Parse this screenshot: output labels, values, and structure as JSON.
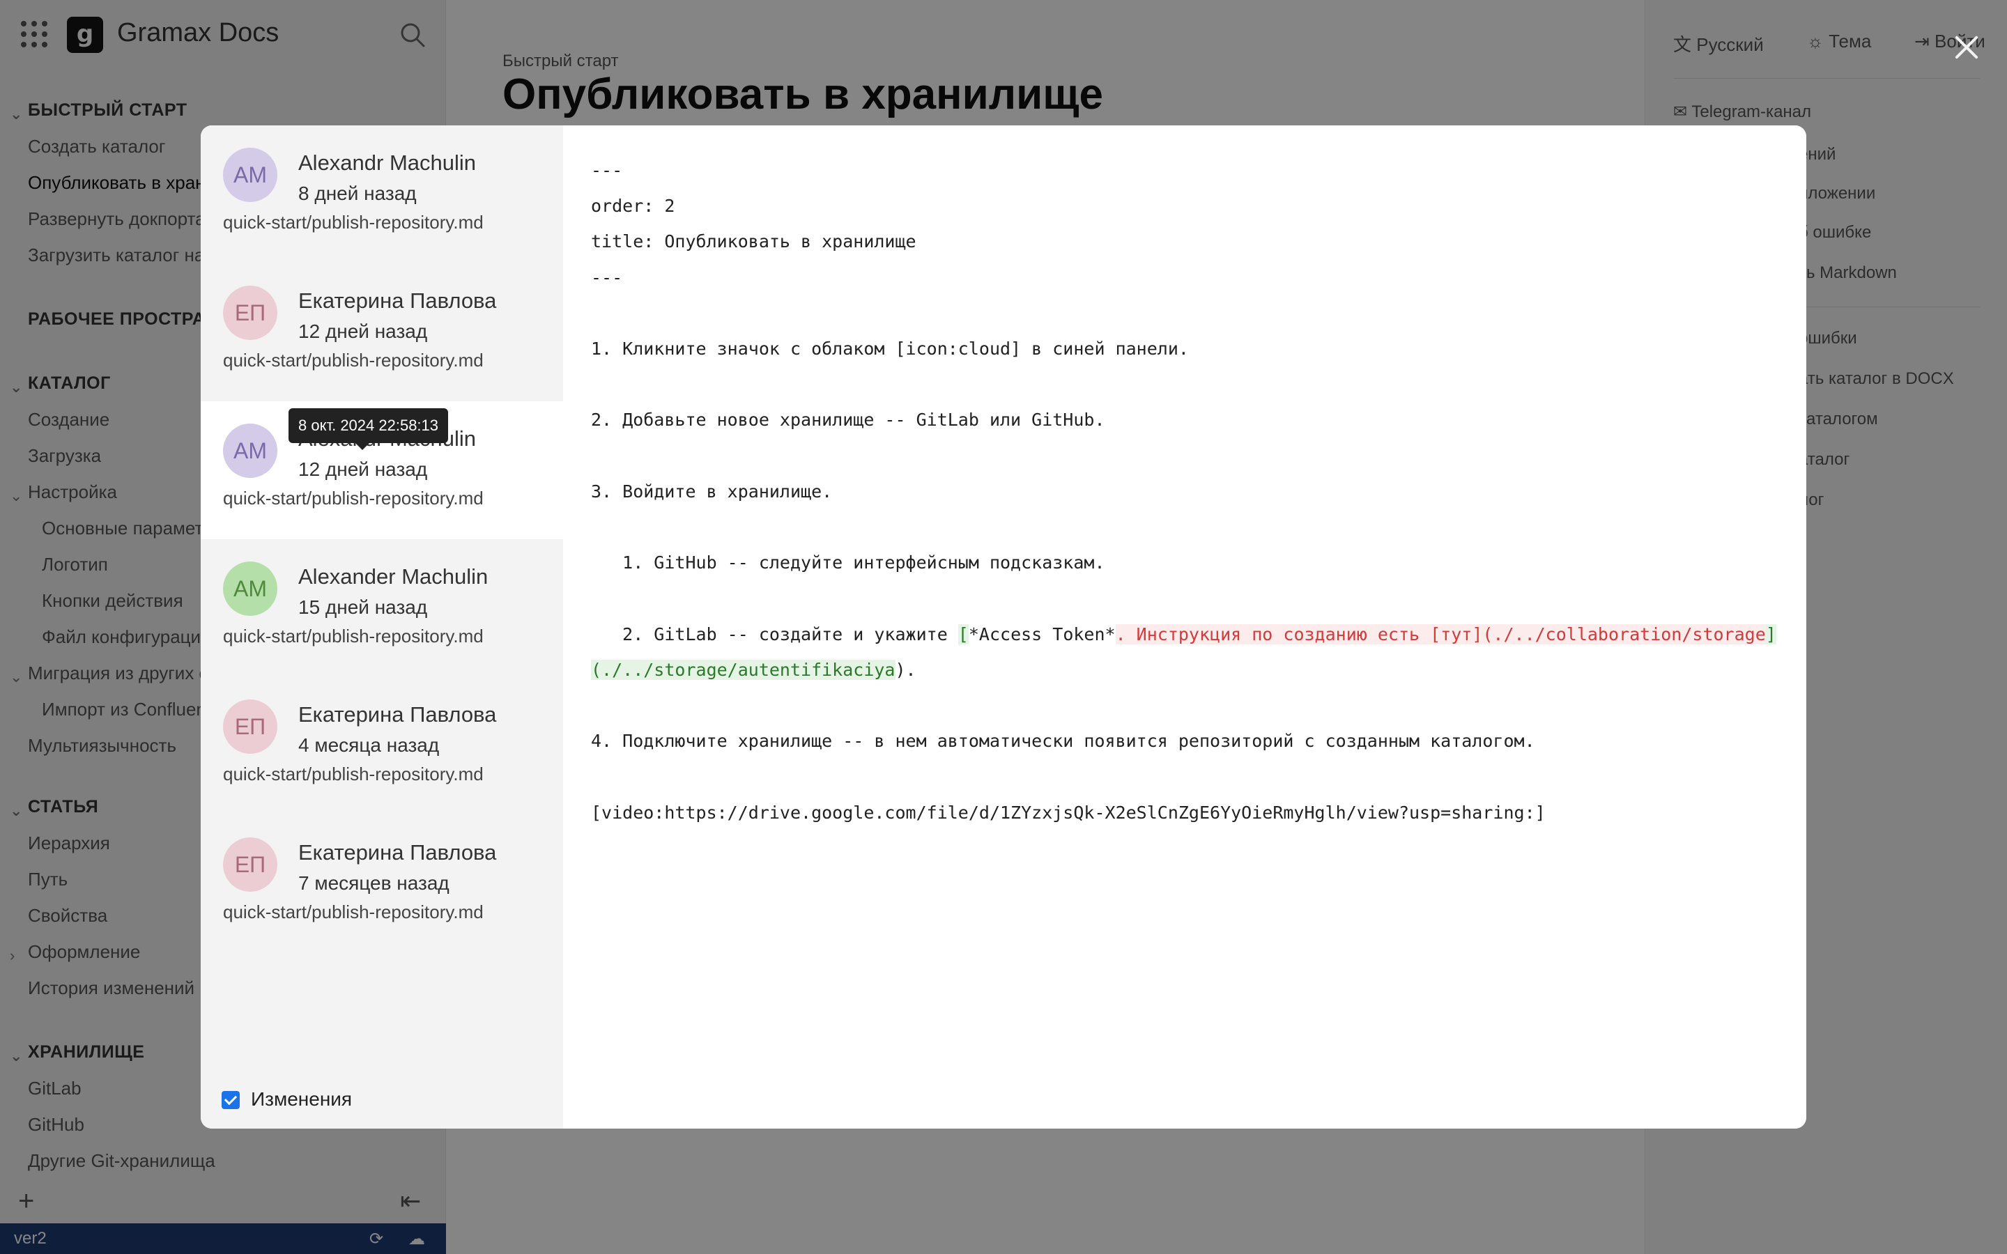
{
  "app": {
    "title": "Gramax Docs",
    "logo_letter": "g"
  },
  "sidebar": {
    "items": [
      {
        "label": "БЫСТРЫЙ СТАРТ",
        "kind": "section",
        "chevron": true
      },
      {
        "label": "Создать каталог",
        "kind": "item"
      },
      {
        "label": "Опубликовать в хранилище",
        "kind": "active"
      },
      {
        "label": "Развернуть докпортал",
        "kind": "item"
      },
      {
        "label": "Загрузить каталог на портал",
        "kind": "item"
      },
      {
        "label": "РАБОЧЕЕ ПРОСТРАНСТВО",
        "kind": "section"
      },
      {
        "label": "КАТАЛОГ",
        "kind": "section",
        "chevron": true
      },
      {
        "label": "Создание",
        "kind": "item"
      },
      {
        "label": "Загрузка",
        "kind": "item"
      },
      {
        "label": "Настройка",
        "kind": "item",
        "chevron": true
      },
      {
        "label": "Основные параметры",
        "kind": "sub"
      },
      {
        "label": "Логотип",
        "kind": "sub"
      },
      {
        "label": "Кнопки действия",
        "kind": "sub"
      },
      {
        "label": "Файл конфигурации",
        "kind": "sub"
      },
      {
        "label": "Миграция из других систем",
        "kind": "item",
        "chevron": true
      },
      {
        "label": "Импорт из Confluence",
        "kind": "sub"
      },
      {
        "label": "Мультиязычность",
        "kind": "item"
      },
      {
        "label": "СТАТЬЯ",
        "kind": "section",
        "chevron": true
      },
      {
        "label": "Иерархия",
        "kind": "item"
      },
      {
        "label": "Путь",
        "kind": "item"
      },
      {
        "label": "Свойства",
        "kind": "item"
      },
      {
        "label": "Оформление",
        "kind": "item",
        "chevron_right": true
      },
      {
        "label": "История изменений",
        "kind": "item"
      },
      {
        "label": "ХРАНИЛИЩЕ",
        "kind": "section",
        "chevron": true
      },
      {
        "label": "GitLab",
        "kind": "item"
      },
      {
        "label": "GitHub",
        "kind": "item"
      },
      {
        "label": "Другие Git-хранилища",
        "kind": "item"
      }
    ],
    "branch": "ver2"
  },
  "main": {
    "breadcrumb": "Быстрый старт",
    "title": "Опубликовать в хранилище"
  },
  "right_panel": {
    "language": "Русский",
    "theme": "Тема",
    "login": "Войти",
    "links": [
      "Telegram-канал",
      "ений",
      "иложении",
      "б ошибке",
      "ть Markdown",
      "ошибки",
      "ать каталог в DOCX",
      "каталогом",
      "аталог",
      "лог"
    ]
  },
  "history": {
    "commits": [
      {
        "initials": "АМ",
        "author": "Alexandr Machulin",
        "ago": "8 дней назад",
        "path": "quick-start/publish-repository.md",
        "color": "#d3cbe8",
        "text_color": "#7b6aa8"
      },
      {
        "initials": "ЕП",
        "author": "Екатерина Павлова",
        "ago": "12 дней назад",
        "path": "quick-start/publish-repository.md",
        "color": "#eccdd3",
        "text_color": "#a86a77"
      },
      {
        "initials": "АМ",
        "author": "Alexandr Machulin",
        "ago": "12 дней назад",
        "path": "quick-start/publish-repository.md",
        "color": "#d3cbe8",
        "text_color": "#7b6aa8",
        "selected": true
      },
      {
        "initials": "АМ",
        "author": "Alexander Machulin",
        "ago": "15 дней назад",
        "path": "quick-start/publish-repository.md",
        "color": "#b5dfa8",
        "text_color": "#4f8a3e"
      },
      {
        "initials": "ЕП",
        "author": "Екатерина Павлова",
        "ago": "4 месяца назад",
        "path": "quick-start/publish-repository.md",
        "color": "#eccdd3",
        "text_color": "#a86a77"
      },
      {
        "initials": "ЕП",
        "author": "Екатерина Павлова",
        "ago": "7 месяцев назад",
        "path": "quick-start/publish-repository.md",
        "color": "#eccdd3",
        "text_color": "#a86a77"
      }
    ],
    "tooltip": "8 окт. 2024 22:58:13",
    "changes_label": "Изменения",
    "changes_checked": true
  },
  "diff": {
    "lines": [
      [
        {
          "t": "---"
        }
      ],
      [
        {
          "t": "order: 2"
        }
      ],
      [
        {
          "t": "title: Опубликовать в хранилище"
        }
      ],
      [
        {
          "t": "---"
        }
      ],
      [
        {
          "t": ""
        }
      ],
      [
        {
          "t": "1. Кликните значок с облаком [icon:cloud] в синей панели."
        }
      ],
      [
        {
          "t": ""
        }
      ],
      [
        {
          "t": "2. Добавьте новое хранилище -- GitLab или GitHub."
        }
      ],
      [
        {
          "t": ""
        }
      ],
      [
        {
          "t": "3. Войдите в хранилище."
        }
      ],
      [
        {
          "t": ""
        }
      ],
      [
        {
          "t": "   1. GitHub -- следуйте интерфейсным подсказкам."
        }
      ],
      [
        {
          "t": ""
        }
      ],
      [
        {
          "t": "   2. GitLab -- создайте и укажите "
        },
        {
          "t": "[",
          "c": "ins"
        },
        {
          "t": "*Access Token*"
        },
        {
          "t": ". Инструкция по созданию есть [тут](./../collaboration/storage",
          "c": "del"
        },
        {
          "t": "]",
          "c": "ins"
        }
      ],
      [
        {
          "t": "(./../storage/autentifikaciya",
          "c": "ins"
        },
        {
          "t": ")."
        }
      ],
      [
        {
          "t": ""
        }
      ],
      [
        {
          "t": "4. Подключите хранилище -- в нем автоматически появится репозиторий с созданным каталогом."
        }
      ],
      [
        {
          "t": ""
        }
      ],
      [
        {
          "t": "[video:https://drive.google.com/file/d/1ZYzxjsQk-X2eSlCnZgE6YyOieRmyHglh/view?usp=sharing:]"
        }
      ]
    ]
  }
}
